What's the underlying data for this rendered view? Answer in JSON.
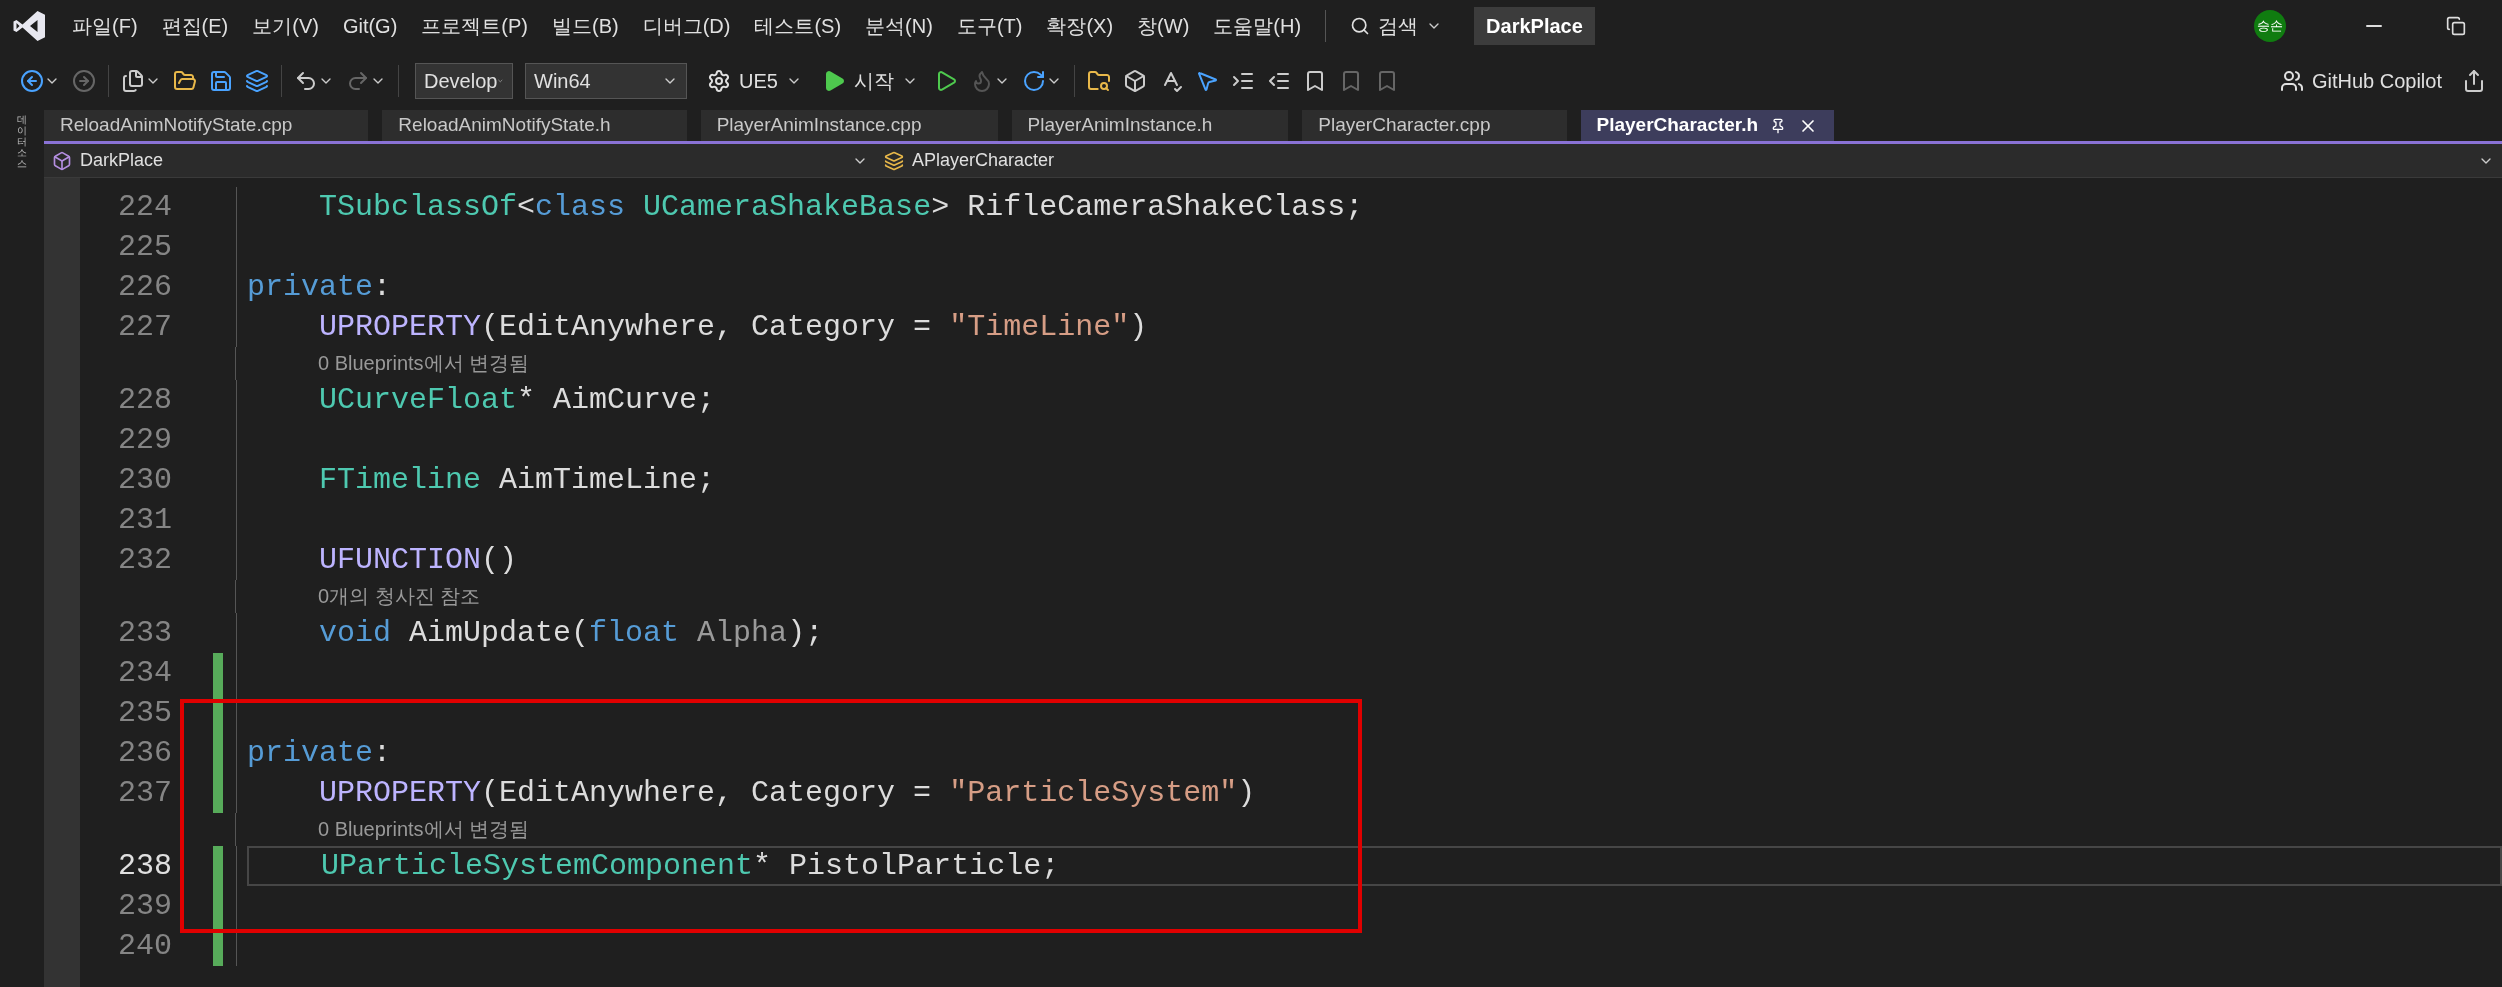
{
  "menu": {
    "items": [
      "파일(F)",
      "편집(E)",
      "보기(V)",
      "Git(G)",
      "프로젝트(P)",
      "빌드(B)",
      "디버그(D)",
      "테스트(S)",
      "분석(N)",
      "도구(T)",
      "확장(X)",
      "창(W)",
      "도움말(H)"
    ],
    "search": "검색",
    "solution": "DarkPlace",
    "avatar": "승손"
  },
  "toolbar": {
    "configuration": "Develop",
    "platform": "Win64",
    "project": "UE5",
    "start": "시작",
    "copilot": "GitHub Copilot"
  },
  "side_panel": {
    "label": "데이터 소스"
  },
  "tabs": [
    {
      "label": "ReloadAnimNotifyState.cpp",
      "selected": false
    },
    {
      "label": "ReloadAnimNotifyState.h",
      "selected": false
    },
    {
      "label": "PlayerAnimInstance.cpp",
      "selected": false
    },
    {
      "label": "PlayerAnimInstance.h",
      "selected": false
    },
    {
      "label": "PlayerCharacter.cpp",
      "selected": false
    },
    {
      "label": "PlayerCharacter.h",
      "selected": true
    }
  ],
  "navigation": {
    "project": "DarkPlace",
    "scope": "APlayerCharacter"
  },
  "lines": [
    {
      "kind": "code",
      "number": "224",
      "changed": false,
      "selected": false,
      "tokens": [
        {
          "kind": "type",
          "text": "    TSubclassOf"
        },
        {
          "kind": "plain",
          "text": "<"
        },
        {
          "kind": "keyword",
          "text": "class"
        },
        {
          "kind": "type",
          "text": " UCameraShakeBase"
        },
        {
          "kind": "plain",
          "text": "> RifleCameraShakeClass;"
        }
      ]
    },
    {
      "kind": "code",
      "number": "225",
      "changed": false,
      "selected": false
    },
    {
      "kind": "code",
      "number": "226",
      "changed": false,
      "selected": false,
      "tokens": [
        {
          "kind": "keyword",
          "text": "private"
        },
        {
          "kind": "plain",
          "text": ":"
        }
      ]
    },
    {
      "kind": "code",
      "number": "227",
      "changed": false,
      "selected": false,
      "tokens": [
        {
          "kind": "macro",
          "text": "    UPROPERTY"
        },
        {
          "kind": "plain",
          "text": "(EditAnywhere, Category = "
        },
        {
          "kind": "string",
          "text": "\"TimeLine\""
        },
        {
          "kind": "plain",
          "text": ")"
        }
      ]
    },
    {
      "kind": "codelens",
      "text": "0 Blueprints에서 변경됨"
    },
    {
      "kind": "code",
      "number": "228",
      "changed": false,
      "selected": false,
      "tokens": [
        {
          "kind": "type",
          "text": "    UCurveFloat"
        },
        {
          "kind": "plain",
          "text": "* AimCurve;"
        }
      ]
    },
    {
      "kind": "code",
      "number": "229",
      "changed": false,
      "selected": false
    },
    {
      "kind": "code",
      "number": "230",
      "changed": false,
      "selected": false,
      "tokens": [
        {
          "kind": "type",
          "text": "    FTimeline"
        },
        {
          "kind": "plain",
          "text": " AimTimeLine;"
        }
      ]
    },
    {
      "kind": "code",
      "number": "231",
      "changed": false,
      "selected": false
    },
    {
      "kind": "code",
      "number": "232",
      "changed": false,
      "selected": false,
      "tokens": [
        {
          "kind": "macro",
          "text": "    UFUNCTION"
        },
        {
          "kind": "plain",
          "text": "()"
        }
      ]
    },
    {
      "kind": "codelens",
      "text": "0개의 청사진 참조"
    },
    {
      "kind": "code",
      "number": "233",
      "changed": false,
      "selected": false,
      "tokens": [
        {
          "kind": "keyword",
          "text": "    void"
        },
        {
          "kind": "plain",
          "text": " AimUpdate("
        },
        {
          "kind": "keyword",
          "text": "float"
        },
        {
          "kind": "param",
          "text": " Alpha"
        },
        {
          "kind": "plain",
          "text": ");"
        }
      ]
    },
    {
      "kind": "code",
      "number": "234",
      "changed": true,
      "selected": false
    },
    {
      "kind": "code",
      "number": "235",
      "changed": true,
      "selected": false
    },
    {
      "kind": "code",
      "number": "236",
      "changed": true,
      "selected": false,
      "tokens": [
        {
          "kind": "keyword",
          "text": "private"
        },
        {
          "kind": "plain",
          "text": ":"
        }
      ]
    },
    {
      "kind": "code",
      "number": "237",
      "changed": true,
      "selected": false,
      "tokens": [
        {
          "kind": "macro",
          "text": "    UPROPERTY"
        },
        {
          "kind": "plain",
          "text": "(EditAnywhere, Category = "
        },
        {
          "kind": "string",
          "text": "\"ParticleSystem\""
        },
        {
          "kind": "plain",
          "text": ")"
        }
      ]
    },
    {
      "kind": "codelens",
      "text": "0 Blueprints에서 변경됨"
    },
    {
      "kind": "code",
      "number": "238",
      "changed": true,
      "selected": true,
      "tokens": [
        {
          "kind": "type",
          "text": "    UParticleSystemComponent"
        },
        {
          "kind": "plain",
          "text": "* PistolParticle;"
        }
      ]
    },
    {
      "kind": "code",
      "number": "239",
      "changed": true,
      "selected": false
    },
    {
      "kind": "code",
      "number": "240",
      "changed": true,
      "selected": false
    }
  ]
}
